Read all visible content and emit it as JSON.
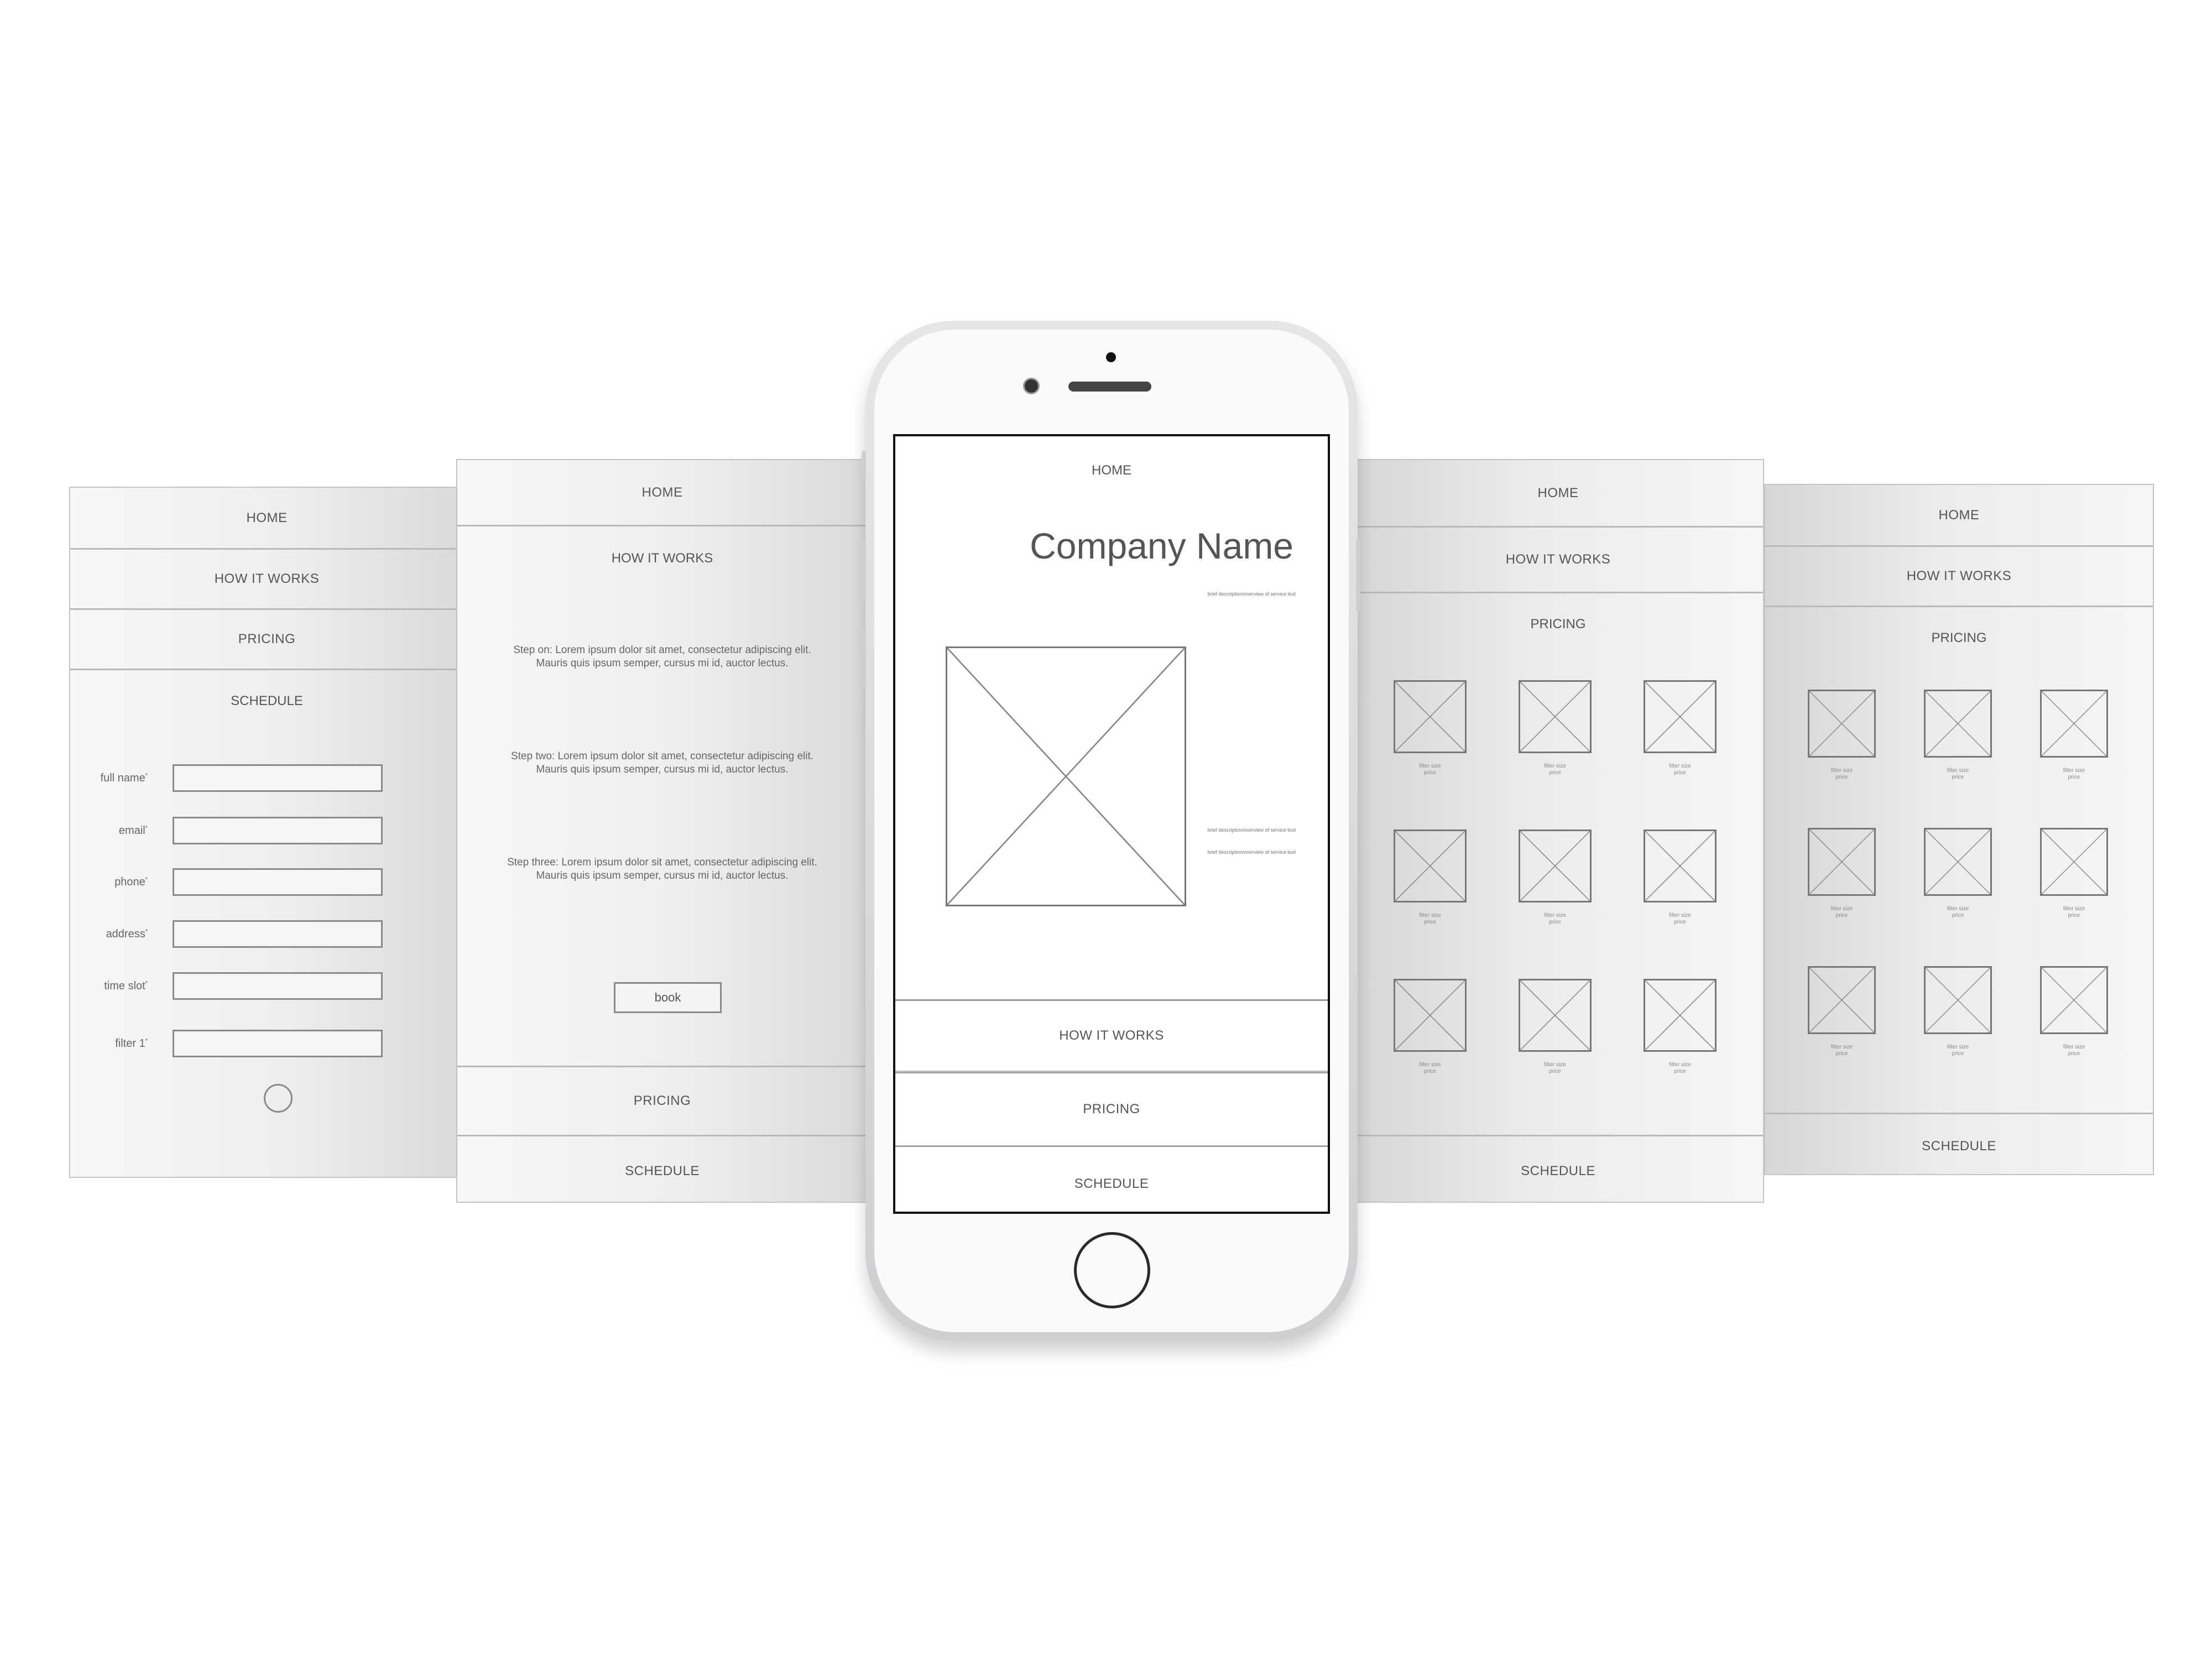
{
  "panel1": {
    "nav": [
      "HOME",
      "HOW IT WORKS",
      "PRICING"
    ],
    "section_title": "SCHEDULE",
    "fields": [
      {
        "label": "full name",
        "mark": "*"
      },
      {
        "label": "email",
        "mark": "*"
      },
      {
        "label": "phone",
        "mark": "*"
      },
      {
        "label": "address",
        "mark": "*"
      },
      {
        "label": "time slot",
        "mark": "*"
      },
      {
        "label": "filter 1",
        "mark": "*"
      }
    ]
  },
  "panel2": {
    "home": "HOME",
    "section_title": "HOW IT WORKS",
    "steps": [
      {
        "line1": "Step on: Lorem ipsum dolor sit amet, consectetur adipiscing elit.",
        "line2": "Mauris quis ipsum semper, cursus mi id, auctor lectus."
      },
      {
        "line1": "Step two: Lorem ipsum dolor sit amet, consectetur adipiscing elit.",
        "line2": "Mauris quis ipsum semper, cursus mi id, auctor lectus."
      },
      {
        "line1": "Step three: Lorem ipsum dolor sit amet, consectetur adipiscing elit.",
        "line2": "Mauris quis ipsum semper, cursus mi id, auctor lectus."
      }
    ],
    "book_label": "book",
    "pricing": "PRICING",
    "schedule": "SCHEDULE"
  },
  "phone": {
    "home": "HOME",
    "company_name": "Company Name",
    "desc1": "brief description/overview of service text",
    "desc2": "brief description/overview of service text",
    "desc3": "brief description/overview of service text",
    "how": "HOW IT WORKS",
    "pricing": "PRICING",
    "schedule": "SCHEDULE"
  },
  "panel4": {
    "home": "HOME",
    "how": "HOW IT WORKS",
    "section_title": "PRICING",
    "item_line1": "filter size",
    "item_line2": "price",
    "schedule": "SCHEDULE"
  },
  "panel5": {
    "home": "HOME",
    "how": "HOW IT WORKS",
    "section_title": "PRICING",
    "item_line1": "filter size",
    "item_line2": "price",
    "schedule": "SCHEDULE"
  }
}
